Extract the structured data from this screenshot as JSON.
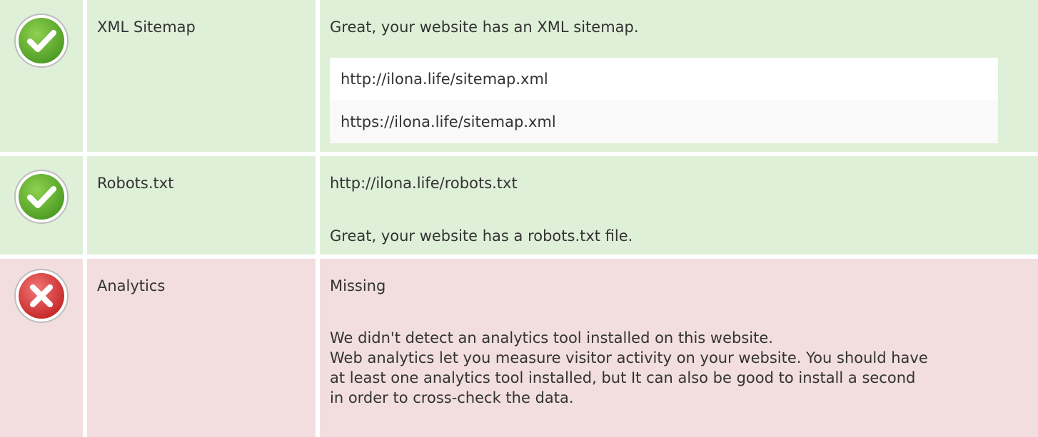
{
  "colors": {
    "pass_bg": "#dff0d8",
    "fail_bg": "#f2dede",
    "pass_icon": "#6bb33b",
    "fail_icon": "#e04545"
  },
  "rows": [
    {
      "status": "pass",
      "icon": "check-icon",
      "name": "XML Sitemap",
      "message": "Great, your website has an XML sitemap.",
      "links": [
        "http://ilona.life/sitemap.xml",
        "https://ilona.life/sitemap.xml"
      ]
    },
    {
      "status": "pass",
      "icon": "check-icon",
      "name": "Robots.txt",
      "url": "http://ilona.life/robots.txt",
      "message": "Great, your website has a robots.txt file."
    },
    {
      "status": "fail",
      "icon": "cross-icon",
      "name": "Analytics",
      "value": "Missing",
      "message": "We didn't detect an analytics tool installed on this website.",
      "advice": "Web analytics let you measure visitor activity on your website. You should have at least one analytics tool installed, but It can also be good to install a second in order to cross-check the data."
    }
  ]
}
